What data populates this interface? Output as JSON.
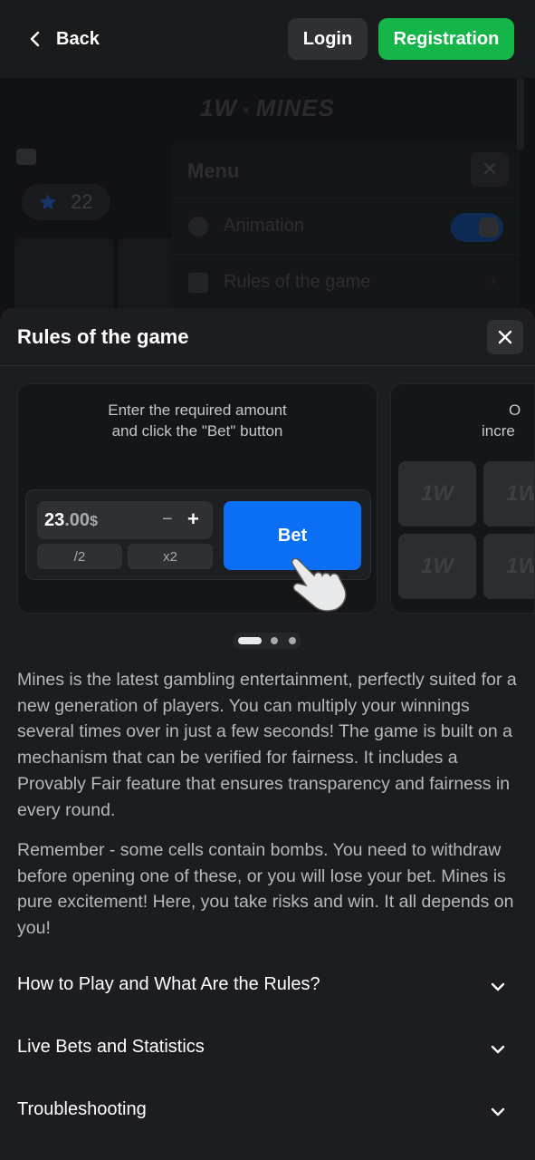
{
  "topbar": {
    "back_label": "Back",
    "login_label": "Login",
    "registration_label": "Registration",
    "login_color": "#2e3033",
    "registration_color": "#16b54a"
  },
  "background_game": {
    "logo_left": "1W",
    "logo_sep": "×",
    "logo_right": "MINES",
    "balance_count": "22",
    "menu": {
      "title": "Menu",
      "items": [
        {
          "label": "Animation",
          "icon": "play-icon",
          "toggle_on": true
        },
        {
          "label": "Rules of the game",
          "icon": "document-icon"
        }
      ]
    }
  },
  "sheet": {
    "title": "Rules of the game",
    "close_icon": "close-icon",
    "carousel": {
      "slides": [
        {
          "caption_line1": "Enter the required amount",
          "caption_line2": "and click the \"Bet\" button",
          "amount_int": "23",
          "amount_dec": ".00",
          "currency": "$",
          "minus": "−",
          "plus": "+",
          "half": "/2",
          "double": "x2",
          "bet_label": "Bet"
        },
        {
          "caption_line1": "O",
          "caption_line2": "incre",
          "tile_label": "1W"
        }
      ],
      "active_index": 0,
      "total": 3
    },
    "paragraphs": [
      "Mines is the latest gambling entertainment, perfectly suited for a new generation of players. You can multiply your winnings several times over in just a few seconds! The game is built on a mechanism that can be verified for fairness. It includes a Provably Fair feature that ensures transparency and fairness in every round.",
      "Remember - some cells contain bombs. You need to withdraw before opening one of these, or you will lose your bet. Mines is pure excitement! Here, you take risks and win. It all depends on you!"
    ],
    "accordion": [
      {
        "label": "How to Play and What Are the Rules?",
        "icon": "chevron-down-icon"
      },
      {
        "label": "Live Bets and Statistics",
        "icon": "chevron-down-icon"
      },
      {
        "label": "Troubleshooting",
        "icon": "chevron-down-icon"
      }
    ],
    "accent_color": "#0a6ff5"
  }
}
